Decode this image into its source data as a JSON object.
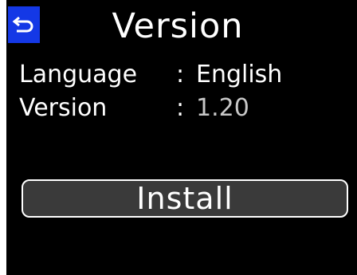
{
  "header": {
    "title": "Version",
    "back_icon": "back-arrow-icon"
  },
  "info": {
    "language": {
      "label": "Language",
      "separator": ":",
      "value": "English"
    },
    "version": {
      "label": "Version",
      "separator": ":",
      "value": "1.20"
    }
  },
  "actions": {
    "install_label": "Install"
  },
  "colors": {
    "background": "#000000",
    "back_button": "#1438e6",
    "install_button": "#3a3a3a",
    "text": "#ffffff",
    "version_value": "#c8c8c8"
  }
}
